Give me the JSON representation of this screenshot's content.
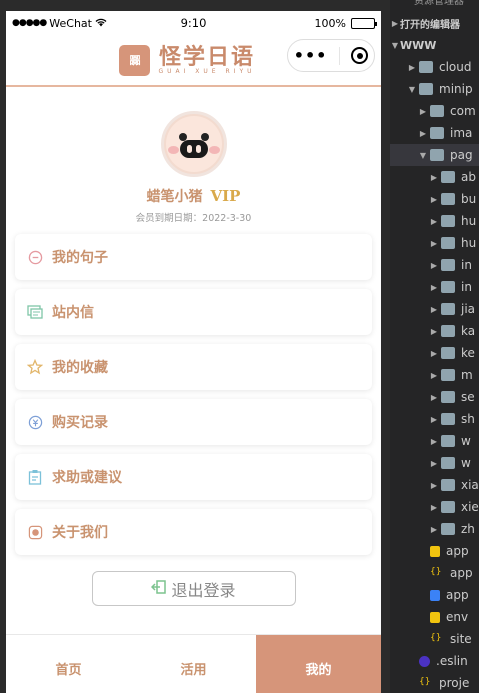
{
  "status_bar": {
    "carrier": "WeChat",
    "time": "9:10",
    "battery": "100%"
  },
  "navbar": {
    "logo_badge": "嚻",
    "brand_cn": "怪学日语",
    "brand_en": "GUAI XUE RIYU"
  },
  "profile": {
    "username": "蜡笔小猪",
    "vip_label": "VIP",
    "expiry": "会员到期日期：2022-3-30"
  },
  "menu": [
    {
      "label": "我的句子",
      "icon": "sentence-icon",
      "color": "#e59aa0"
    },
    {
      "label": "站内信",
      "icon": "message-icon",
      "color": "#7fc5a8"
    },
    {
      "label": "我的收藏",
      "icon": "star-icon",
      "color": "#e2b66b"
    },
    {
      "label": "购买记录",
      "icon": "purchase-icon",
      "color": "#7d9fd6"
    },
    {
      "label": "求助或建议",
      "icon": "clipboard-icon",
      "color": "#7cc1d9"
    },
    {
      "label": "关于我们",
      "icon": "about-icon",
      "color": "#d6957a"
    }
  ],
  "logout_label": "退出登录",
  "tabs": [
    {
      "label": "首页",
      "active": false
    },
    {
      "label": "活用",
      "active": false
    },
    {
      "label": "我的",
      "active": true
    }
  ],
  "ide": {
    "header": "资源管理器",
    "open_editors": "打开的编辑器",
    "root": "WWW",
    "items": [
      {
        "name": "cloud",
        "type": "folder",
        "depth": 1
      },
      {
        "name": "minip",
        "type": "folder-open",
        "depth": 1
      },
      {
        "name": "com",
        "type": "folder",
        "depth": 2
      },
      {
        "name": "ima",
        "type": "folder",
        "depth": 2
      },
      {
        "name": "pag",
        "type": "folder-open",
        "depth": 2
      },
      {
        "name": "ab",
        "type": "folder",
        "depth": 3
      },
      {
        "name": "bu",
        "type": "folder",
        "depth": 3
      },
      {
        "name": "hu",
        "type": "folder",
        "depth": 3
      },
      {
        "name": "hu",
        "type": "folder",
        "depth": 3
      },
      {
        "name": "in",
        "type": "folder",
        "depth": 3
      },
      {
        "name": "in",
        "type": "folder",
        "depth": 3
      },
      {
        "name": "jia",
        "type": "folder",
        "depth": 3
      },
      {
        "name": "ka",
        "type": "folder",
        "depth": 3
      },
      {
        "name": "ke",
        "type": "folder",
        "depth": 3
      },
      {
        "name": "m",
        "type": "folder",
        "depth": 3
      },
      {
        "name": "se",
        "type": "folder",
        "depth": 3
      },
      {
        "name": "sh",
        "type": "folder",
        "depth": 3
      },
      {
        "name": "w",
        "type": "folder",
        "depth": 3
      },
      {
        "name": "w",
        "type": "folder",
        "depth": 3
      },
      {
        "name": "xia",
        "type": "folder",
        "depth": 3
      },
      {
        "name": "xie",
        "type": "folder",
        "depth": 3
      },
      {
        "name": "zh",
        "type": "folder",
        "depth": 3
      },
      {
        "name": "app",
        "type": "js",
        "depth": 2
      },
      {
        "name": "app",
        "type": "json",
        "depth": 2
      },
      {
        "name": "app",
        "type": "css",
        "depth": 2
      },
      {
        "name": "env",
        "type": "js",
        "depth": 2
      },
      {
        "name": "site",
        "type": "json",
        "depth": 2
      },
      {
        "name": ".eslin",
        "type": "eslint",
        "depth": 1
      },
      {
        "name": "proje",
        "type": "json",
        "depth": 1
      }
    ]
  }
}
